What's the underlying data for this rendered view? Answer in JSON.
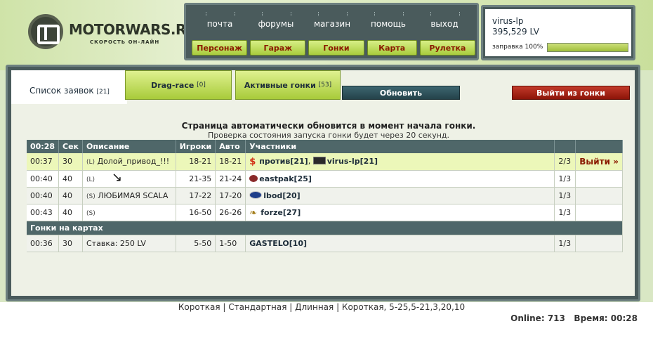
{
  "logo": {
    "title": "MOTORWARS.RU",
    "subtitle": "СКОРОСТЬ ОН-ЛАЙН"
  },
  "nav": {
    "links": [
      "почта",
      "форумы",
      "магазин",
      "помощь",
      "выход"
    ],
    "buttons": [
      "Персонаж",
      "Гараж",
      "Гонки",
      "Карта",
      "Рулетка"
    ]
  },
  "user": {
    "name": "virus-lp",
    "money": "395,529 LV",
    "fuel_label": "заправка 100%",
    "fuel_percent": 100
  },
  "tabs": {
    "list_label": "Список заявок",
    "list_count": "[21]",
    "drag_label": "Drag-race",
    "drag_count": "[0]",
    "active_label": "Активные гонки",
    "active_count": "[53]",
    "refresh": "Обновить",
    "leave": "Выйти из гонки"
  },
  "notice": {
    "main": "Страница автоматически обновится в момент начала гонки.",
    "sub": "Проверка состояния запуска гонки будет через 20 секунд."
  },
  "table": {
    "headers": [
      "00:28",
      "Сек",
      "Описание",
      "Игроки",
      "Авто",
      "Участники",
      "",
      ""
    ],
    "rows": [
      {
        "time": "00:37",
        "sec": "30",
        "tag": "(L)",
        "desc": "Долой_привод_!!!",
        "players": "18-21",
        "auto": "18-21",
        "p1_icon": "dollar-icon",
        "p1_name": "против",
        "p1_lvl": "[21]",
        "sep": ",",
        "p2_icon": "dark-badge-icon",
        "p2_name": "virus-lp",
        "p2_lvl": "[21]",
        "count": "2/3",
        "action": "Выйти »"
      },
      {
        "time": "00:40",
        "sec": "40",
        "tag": "(L)",
        "desc": "",
        "players": "21-35",
        "auto": "21-24",
        "p1_icon": "mazda-badge-icon",
        "p1_name": "eastpak",
        "p1_lvl": "[25]",
        "count": "1/3"
      },
      {
        "time": "00:40",
        "sec": "40",
        "tag": "(S)",
        "desc": "ЛЮБИМАЯ SCALA",
        "players": "17-22",
        "auto": "17-20",
        "p1_icon": "ford-badge-icon",
        "p1_name": "lbod",
        "p1_lvl": "[20]",
        "count": "1/3"
      },
      {
        "time": "00:43",
        "sec": "40",
        "tag": "(S)",
        "desc": "",
        "players": "16-50",
        "auto": "26-26",
        "p1_icon": "wing-badge-icon",
        "p1_name": "forze",
        "p1_lvl": "[27]",
        "count": "1/3"
      }
    ],
    "section": "Гонки на картах",
    "map_row": {
      "time": "00:36",
      "sec": "30",
      "desc": "Ставка: 250 LV",
      "players": "5-50",
      "auto": "1-50",
      "p1_name": "GASTELO",
      "p1_lvl": "[10]",
      "count": "1/3"
    }
  },
  "footer": {
    "links": [
      "Короткая",
      "Стандартная",
      "Длинная",
      "Короткая, 5-25,5-21,3,20,10"
    ],
    "online_label": "Online:",
    "online": "713",
    "time_label": "Время:",
    "time": "00:28"
  },
  "colors": {
    "accent_green": "#a8cb3a",
    "panel": "#4a5b5c",
    "exit": "#8a1a00"
  }
}
